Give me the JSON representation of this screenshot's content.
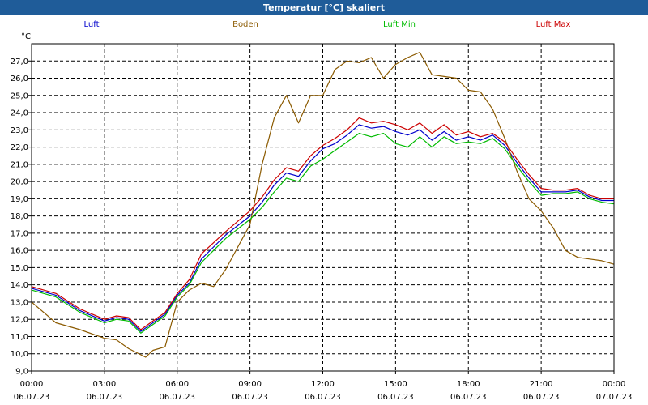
{
  "window": {
    "title": "Temperatur [°C] skaliert"
  },
  "chart_data": {
    "type": "line",
    "title": "Temperatur [°C] skaliert",
    "ylabel": "°C",
    "xlabel": "",
    "ylim": [
      9.0,
      28.0
    ],
    "xlim": [
      0,
      24
    ],
    "grid": true,
    "legend_placement": "top",
    "y_ticks": [
      "9,0",
      "10,0",
      "11,0",
      "12,0",
      "13,0",
      "14,0",
      "15,0",
      "16,0",
      "17,0",
      "18,0",
      "19,0",
      "20,0",
      "21,0",
      "22,0",
      "23,0",
      "24,0",
      "25,0",
      "26,0",
      "27,0"
    ],
    "x_ticks": [
      {
        "time": "00:00",
        "date": "06.07.23"
      },
      {
        "time": "03:00",
        "date": "06.07.23"
      },
      {
        "time": "06:00",
        "date": "06.07.23"
      },
      {
        "time": "09:00",
        "date": "06.07.23"
      },
      {
        "time": "12:00",
        "date": "06.07.23"
      },
      {
        "time": "15:00",
        "date": "06.07.23"
      },
      {
        "time": "18:00",
        "date": "06.07.23"
      },
      {
        "time": "21:00",
        "date": "06.07.23"
      },
      {
        "time": "00:00",
        "date": "07.07.23"
      }
    ],
    "series": [
      {
        "name": "Luft",
        "color": "#0000cc",
        "points": [
          [
            0,
            13.8
          ],
          [
            1,
            13.4
          ],
          [
            2,
            12.5
          ],
          [
            3,
            11.9
          ],
          [
            3.5,
            12.1
          ],
          [
            4,
            12.0
          ],
          [
            4.5,
            11.3
          ],
          [
            5,
            11.8
          ],
          [
            5.5,
            12.3
          ],
          [
            6,
            13.4
          ],
          [
            6.5,
            14.1
          ],
          [
            7,
            15.5
          ],
          [
            8,
            16.9
          ],
          [
            9,
            18.0
          ],
          [
            9.5,
            18.8
          ],
          [
            10,
            19.8
          ],
          [
            10.5,
            20.5
          ],
          [
            11,
            20.3
          ],
          [
            11.5,
            21.2
          ],
          [
            12,
            21.9
          ],
          [
            12.5,
            22.2
          ],
          [
            13,
            22.7
          ],
          [
            13.5,
            23.3
          ],
          [
            14,
            23.1
          ],
          [
            14.5,
            23.2
          ],
          [
            15,
            22.9
          ],
          [
            15.5,
            22.7
          ],
          [
            16,
            23.0
          ],
          [
            16.5,
            22.4
          ],
          [
            17,
            22.9
          ],
          [
            17.5,
            22.4
          ],
          [
            18,
            22.6
          ],
          [
            18.5,
            22.4
          ],
          [
            19,
            22.7
          ],
          [
            19.5,
            22.1
          ],
          [
            20,
            21.1
          ],
          [
            20.5,
            20.2
          ],
          [
            21,
            19.4
          ],
          [
            21.5,
            19.4
          ],
          [
            22,
            19.4
          ],
          [
            22.5,
            19.5
          ],
          [
            23,
            19.1
          ],
          [
            23.5,
            18.9
          ],
          [
            24,
            18.9
          ]
        ]
      },
      {
        "name": "Boden",
        "color": "#8b5a00",
        "points": [
          [
            0,
            13.0
          ],
          [
            0.5,
            12.4
          ],
          [
            1,
            11.8
          ],
          [
            2,
            11.4
          ],
          [
            3,
            10.9
          ],
          [
            3.5,
            10.8
          ],
          [
            4,
            10.3
          ],
          [
            4.7,
            9.8
          ],
          [
            5,
            10.2
          ],
          [
            5.5,
            10.4
          ],
          [
            6,
            13.0
          ],
          [
            6.5,
            13.7
          ],
          [
            7,
            14.1
          ],
          [
            7.5,
            13.9
          ],
          [
            8,
            14.9
          ],
          [
            9,
            17.5
          ],
          [
            9.5,
            21.0
          ],
          [
            10,
            23.7
          ],
          [
            10.5,
            25.0
          ],
          [
            11,
            23.4
          ],
          [
            11.5,
            25.0
          ],
          [
            12,
            25.0
          ],
          [
            12.5,
            26.5
          ],
          [
            13,
            27.0
          ],
          [
            13.5,
            26.9
          ],
          [
            14,
            27.2
          ],
          [
            14.5,
            26.0
          ],
          [
            15,
            26.8
          ],
          [
            15.5,
            27.2
          ],
          [
            16,
            27.5
          ],
          [
            16.5,
            26.2
          ],
          [
            17,
            26.1
          ],
          [
            17.5,
            26.0
          ],
          [
            18,
            25.3
          ],
          [
            18.5,
            25.2
          ],
          [
            19,
            24.2
          ],
          [
            19.5,
            22.5
          ],
          [
            20,
            20.6
          ],
          [
            20.5,
            19.0
          ],
          [
            21,
            18.3
          ],
          [
            21.5,
            17.3
          ],
          [
            22,
            16.0
          ],
          [
            22.5,
            15.6
          ],
          [
            23,
            15.5
          ],
          [
            23.5,
            15.4
          ],
          [
            24,
            15.2
          ]
        ]
      },
      {
        "name": "Luft Min",
        "color": "#00bb00",
        "points": [
          [
            0,
            13.7
          ],
          [
            1,
            13.3
          ],
          [
            2,
            12.4
          ],
          [
            3,
            11.8
          ],
          [
            3.5,
            12.0
          ],
          [
            4,
            11.9
          ],
          [
            4.5,
            11.2
          ],
          [
            5,
            11.7
          ],
          [
            5.5,
            12.2
          ],
          [
            6,
            13.3
          ],
          [
            6.5,
            14.0
          ],
          [
            7,
            15.3
          ],
          [
            8,
            16.7
          ],
          [
            9,
            17.8
          ],
          [
            9.5,
            18.5
          ],
          [
            10,
            19.4
          ],
          [
            10.5,
            20.2
          ],
          [
            11,
            20.0
          ],
          [
            11.5,
            20.9
          ],
          [
            12,
            21.3
          ],
          [
            12.5,
            21.8
          ],
          [
            13,
            22.3
          ],
          [
            13.5,
            22.8
          ],
          [
            14,
            22.6
          ],
          [
            14.5,
            22.8
          ],
          [
            15,
            22.2
          ],
          [
            15.5,
            22.0
          ],
          [
            16,
            22.6
          ],
          [
            16.5,
            22.0
          ],
          [
            17,
            22.6
          ],
          [
            17.5,
            22.2
          ],
          [
            18,
            22.3
          ],
          [
            18.5,
            22.2
          ],
          [
            19,
            22.5
          ],
          [
            19.5,
            21.9
          ],
          [
            20,
            20.9
          ],
          [
            20.5,
            20.0
          ],
          [
            21,
            19.2
          ],
          [
            21.5,
            19.3
          ],
          [
            22,
            19.3
          ],
          [
            22.5,
            19.4
          ],
          [
            23,
            19.0
          ],
          [
            23.5,
            18.8
          ],
          [
            24,
            18.7
          ]
        ]
      },
      {
        "name": "Luft Max",
        "color": "#cc0000",
        "points": [
          [
            0,
            13.9
          ],
          [
            1,
            13.5
          ],
          [
            2,
            12.6
          ],
          [
            3,
            12.0
          ],
          [
            3.5,
            12.2
          ],
          [
            4,
            12.1
          ],
          [
            4.5,
            11.4
          ],
          [
            5,
            11.9
          ],
          [
            5.5,
            12.4
          ],
          [
            6,
            13.5
          ],
          [
            6.5,
            14.3
          ],
          [
            7,
            15.8
          ],
          [
            8,
            17.1
          ],
          [
            9,
            18.3
          ],
          [
            9.5,
            19.1
          ],
          [
            10,
            20.1
          ],
          [
            10.5,
            20.8
          ],
          [
            11,
            20.6
          ],
          [
            11.5,
            21.5
          ],
          [
            12,
            22.1
          ],
          [
            12.5,
            22.5
          ],
          [
            13,
            23.0
          ],
          [
            13.5,
            23.7
          ],
          [
            14,
            23.4
          ],
          [
            14.5,
            23.5
          ],
          [
            15,
            23.3
          ],
          [
            15.5,
            23.0
          ],
          [
            16,
            23.4
          ],
          [
            16.5,
            22.8
          ],
          [
            17,
            23.3
          ],
          [
            17.5,
            22.7
          ],
          [
            18,
            22.9
          ],
          [
            18.5,
            22.6
          ],
          [
            19,
            22.8
          ],
          [
            19.5,
            22.3
          ],
          [
            20,
            21.3
          ],
          [
            20.5,
            20.4
          ],
          [
            21,
            19.6
          ],
          [
            21.5,
            19.5
          ],
          [
            22,
            19.5
          ],
          [
            22.5,
            19.6
          ],
          [
            23,
            19.2
          ],
          [
            23.5,
            19.0
          ],
          [
            24,
            19.0
          ]
        ]
      }
    ]
  }
}
